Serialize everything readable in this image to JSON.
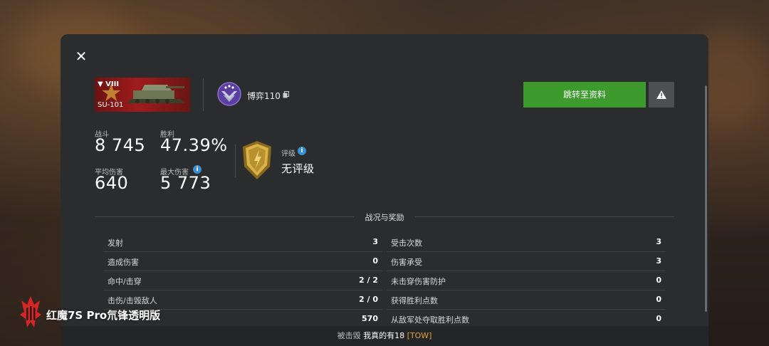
{
  "tank": {
    "tier": "▼ VIII",
    "name": "SU-101"
  },
  "player": {
    "name": "博弈110"
  },
  "buttons": {
    "goto_profile": "跳转至资料"
  },
  "stats": {
    "battles_label": "战斗",
    "battles_value": "8 745",
    "wins_label": "胜利",
    "wins_value": "47.39%",
    "avg_damage_label": "平均伤害",
    "avg_damage_value": "640",
    "max_damage_label": "最大伤害",
    "max_damage_value": "5 773",
    "rating_label": "评级",
    "rating_value": "无评级"
  },
  "section_title": "战况与奖励",
  "left_rows": [
    {
      "label": "发射",
      "value": "3"
    },
    {
      "label": "造成伤害",
      "value": "0"
    },
    {
      "label": "命中/击穿",
      "value": "2 / 2"
    },
    {
      "label": "击伤/击毁敌人",
      "value": "2 / 0"
    },
    {
      "label": "",
      "value": "570"
    }
  ],
  "right_rows": [
    {
      "label": "受击次数",
      "value": "3"
    },
    {
      "label": "伤害承受",
      "value": "3"
    },
    {
      "label": "未击穿伤害防护",
      "value": "0"
    },
    {
      "label": "获得胜利点数",
      "value": "0"
    },
    {
      "label": "从敌军处夺取胜利点数",
      "value": "0"
    }
  ],
  "footer": {
    "destroyed_by": "被击毁",
    "player": "我真的有18",
    "clan": "[TOW]"
  },
  "watermark": {
    "text": "红魔7S Pro氘锋透明版"
  },
  "colors": {
    "accent_green": "#3d9a2d",
    "tank_red": "#a01c1c",
    "clan_orange": "#e5a13c",
    "info_blue": "#3a8fd0"
  }
}
